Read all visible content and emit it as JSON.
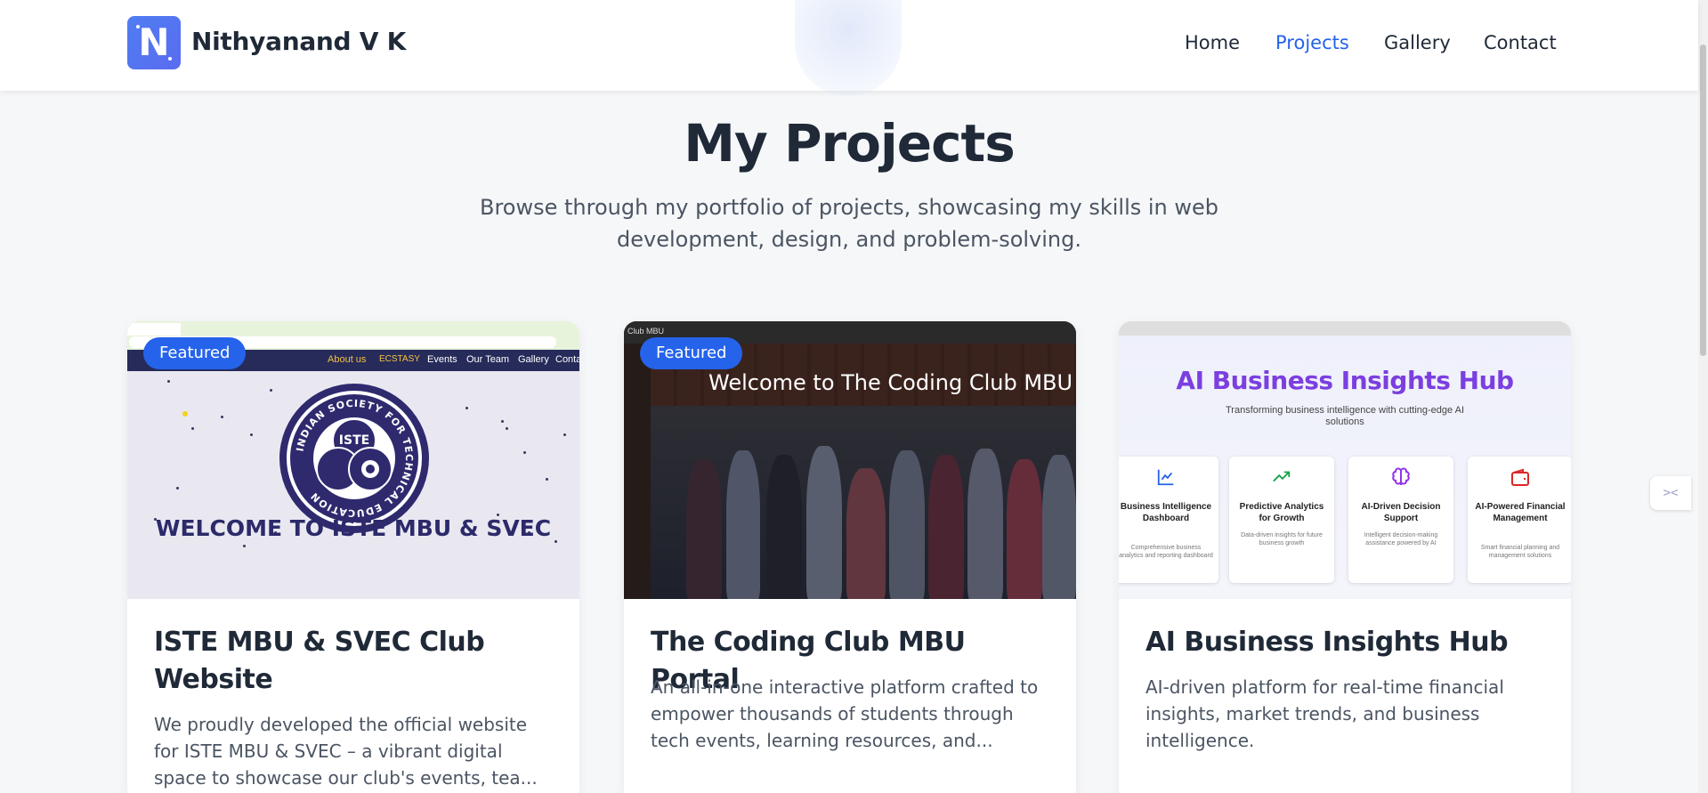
{
  "brand": {
    "logo_letter": "N",
    "name": "Nithyanand V K"
  },
  "nav": {
    "items": [
      "Home",
      "Projects",
      "Gallery",
      "Contact"
    ],
    "active": "Projects"
  },
  "hero": {
    "title": "My Projects",
    "subtitle": "Browse through my portfolio of projects, showcasing my skills in web development, design, and problem-solving."
  },
  "projects": [
    {
      "badge": "Featured",
      "title": "ISTE MBU & SVEC Club Website",
      "description": "We proudly developed the official website for ISTE MBU & SVEC – a vibrant digital space to showcase our club's events, tea...",
      "preview": {
        "nav_links": [
          "About us",
          "ECSTASY",
          "Events",
          "Our Team",
          "Gallery",
          "Conta"
        ],
        "seal_text": "INDIAN SOCIETY FOR TECHNICAL EDUCATION",
        "seal_center": "ISTE",
        "welcome": "WELCOME TO ISTE MBU & SVEC"
      }
    },
    {
      "badge": "Featured",
      "title": "The Coding Club MBU Portal",
      "description": "An all-in-one interactive platform crafted to empower thousands of students through tech events, learning resources, and...",
      "preview": {
        "tab": "Club MBU",
        "welcome": "Welcome to The Coding Club MBU"
      }
    },
    {
      "badge": "",
      "title": "AI Business Insights Hub",
      "description": "AI-driven platform for real-time financial insights, market trends, and business intelligence.",
      "preview": {
        "title": "AI Business Insights Hub",
        "subtitle": "Transforming business intelligence with cutting-edge AI solutions",
        "features": [
          {
            "icon": "chart-line-icon",
            "title": "Business Intelligence Dashboard",
            "desc": "Comprehensive business analytics and reporting dashboard"
          },
          {
            "icon": "trending-up-icon",
            "title": "Predictive Analytics for Growth",
            "desc": "Data-driven insights for future business growth"
          },
          {
            "icon": "brain-icon",
            "title": "AI-Driven Decision Support",
            "desc": "Intelligent decision-making assistance powered by AI"
          },
          {
            "icon": "wallet-icon",
            "title": "AI-Powered Financial Management",
            "desc": "Smart financial planning and management solutions"
          }
        ]
      }
    }
  ],
  "colors": {
    "accent": "#2563eb",
    "brand_gradient_start": "#4f7df2",
    "ai_title": "#7b3fe0"
  }
}
